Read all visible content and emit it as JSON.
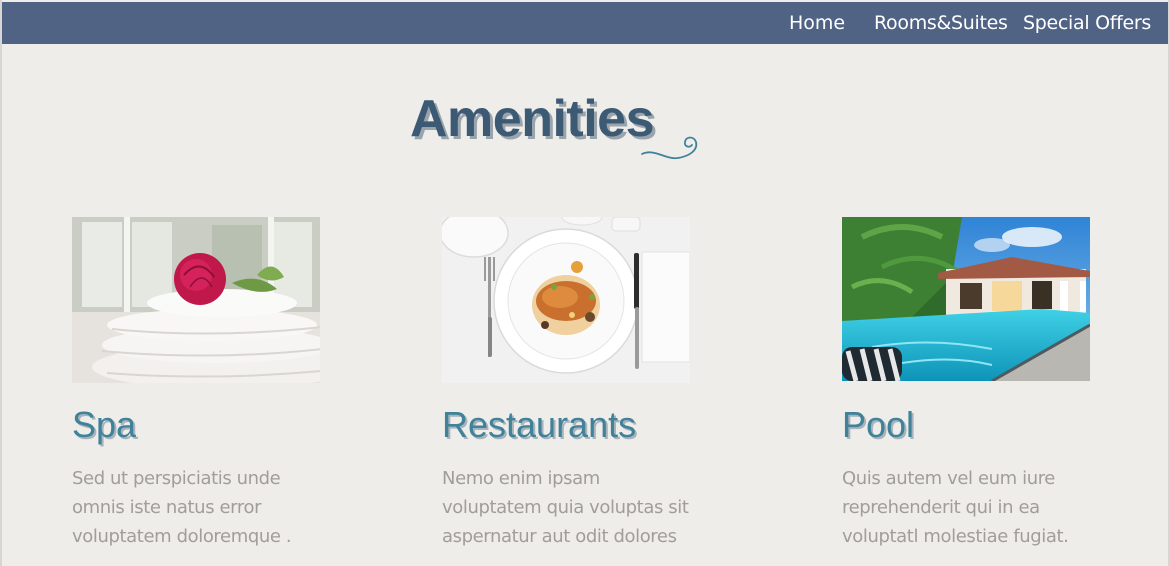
{
  "nav": {
    "items": [
      {
        "label": "Home"
      },
      {
        "label": "Rooms&Suites"
      },
      {
        "label": "Special Offers"
      }
    ]
  },
  "section": {
    "title": "Amenities"
  },
  "cards": [
    {
      "title": "Spa",
      "image": "towels-with-rose-photo",
      "lines": [
        "Sed ut perspiciatis unde",
        "omnis iste natus error",
        "voluptatem  doloremque ."
      ]
    },
    {
      "title": "Restaurants",
      "image": "plated-dish-photo",
      "lines": [
        "Nemo enim ipsam",
        "voluptatem quia voluptas sit",
        "aspernatur aut odit dolores"
      ]
    },
    {
      "title": "Pool",
      "image": "resort-pool-photo",
      "lines": [
        "Quis autem vel eum iure",
        "reprehenderit qui in ea",
        "voluptatl molestiae fugiat."
      ]
    }
  ],
  "colors": {
    "navbar": "#506384",
    "background": "#efede9",
    "heading": "#3d5a74",
    "card_title": "#3f8299",
    "body_text": "#a19d99"
  }
}
